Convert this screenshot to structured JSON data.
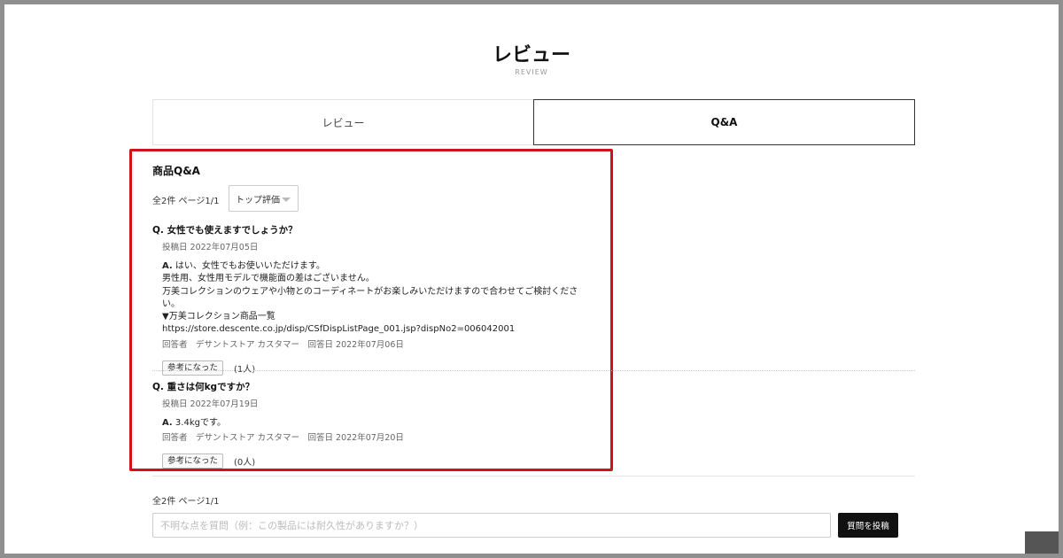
{
  "header": {
    "title": "レビュー",
    "subtitle": "REVIEW"
  },
  "tabs": [
    {
      "label": "レビュー",
      "active": false
    },
    {
      "label": "Q&A",
      "active": true
    }
  ],
  "qa_section": {
    "title": "商品Q&A",
    "count_label": "全2件 ページ1/1",
    "sort": {
      "selected": "トップ評価"
    },
    "items": [
      {
        "question": "Q. 女性でも使えますでしょうか？",
        "posted": "投稿日 2022年07月05日",
        "answer_mark": "A.",
        "answer_lines": [
          "はい、女性でもお使いいただけます。",
          "男性用、女性用モデルで機能面の差はございません。",
          "万美コレクションのウェアや小物とのコーディネートがお楽しみいただけますので合わせてご検討ください。",
          "▼万美コレクション商品一覧",
          "https://store.descente.co.jp/disp/CSfDispListPage_001.jsp?dispNo2=006042001"
        ],
        "answerer": "回答者　デサントストア カスタマー　回答日 2022年07月06日",
        "helpful_label": "参考になった",
        "helpful_count": "(1人)"
      },
      {
        "question": "Q. 重さは何kgですか？",
        "posted": "投稿日 2022年07月19日",
        "answer_mark": "A.",
        "answer_lines": [
          "3.4kgです。"
        ],
        "answerer": "回答者　デサントストア カスタマー　回答日 2022年07月20日",
        "helpful_label": "参考になった",
        "helpful_count": "(0人)"
      }
    ]
  },
  "footer": {
    "count_label": "全2件 ページ1/1",
    "input_placeholder": "不明な点を質問（例：この製品には耐久性がありますか？）",
    "submit_label": "質問を投稿"
  },
  "colors": {
    "highlight": "#d0121b",
    "button_dark": "#111111"
  }
}
